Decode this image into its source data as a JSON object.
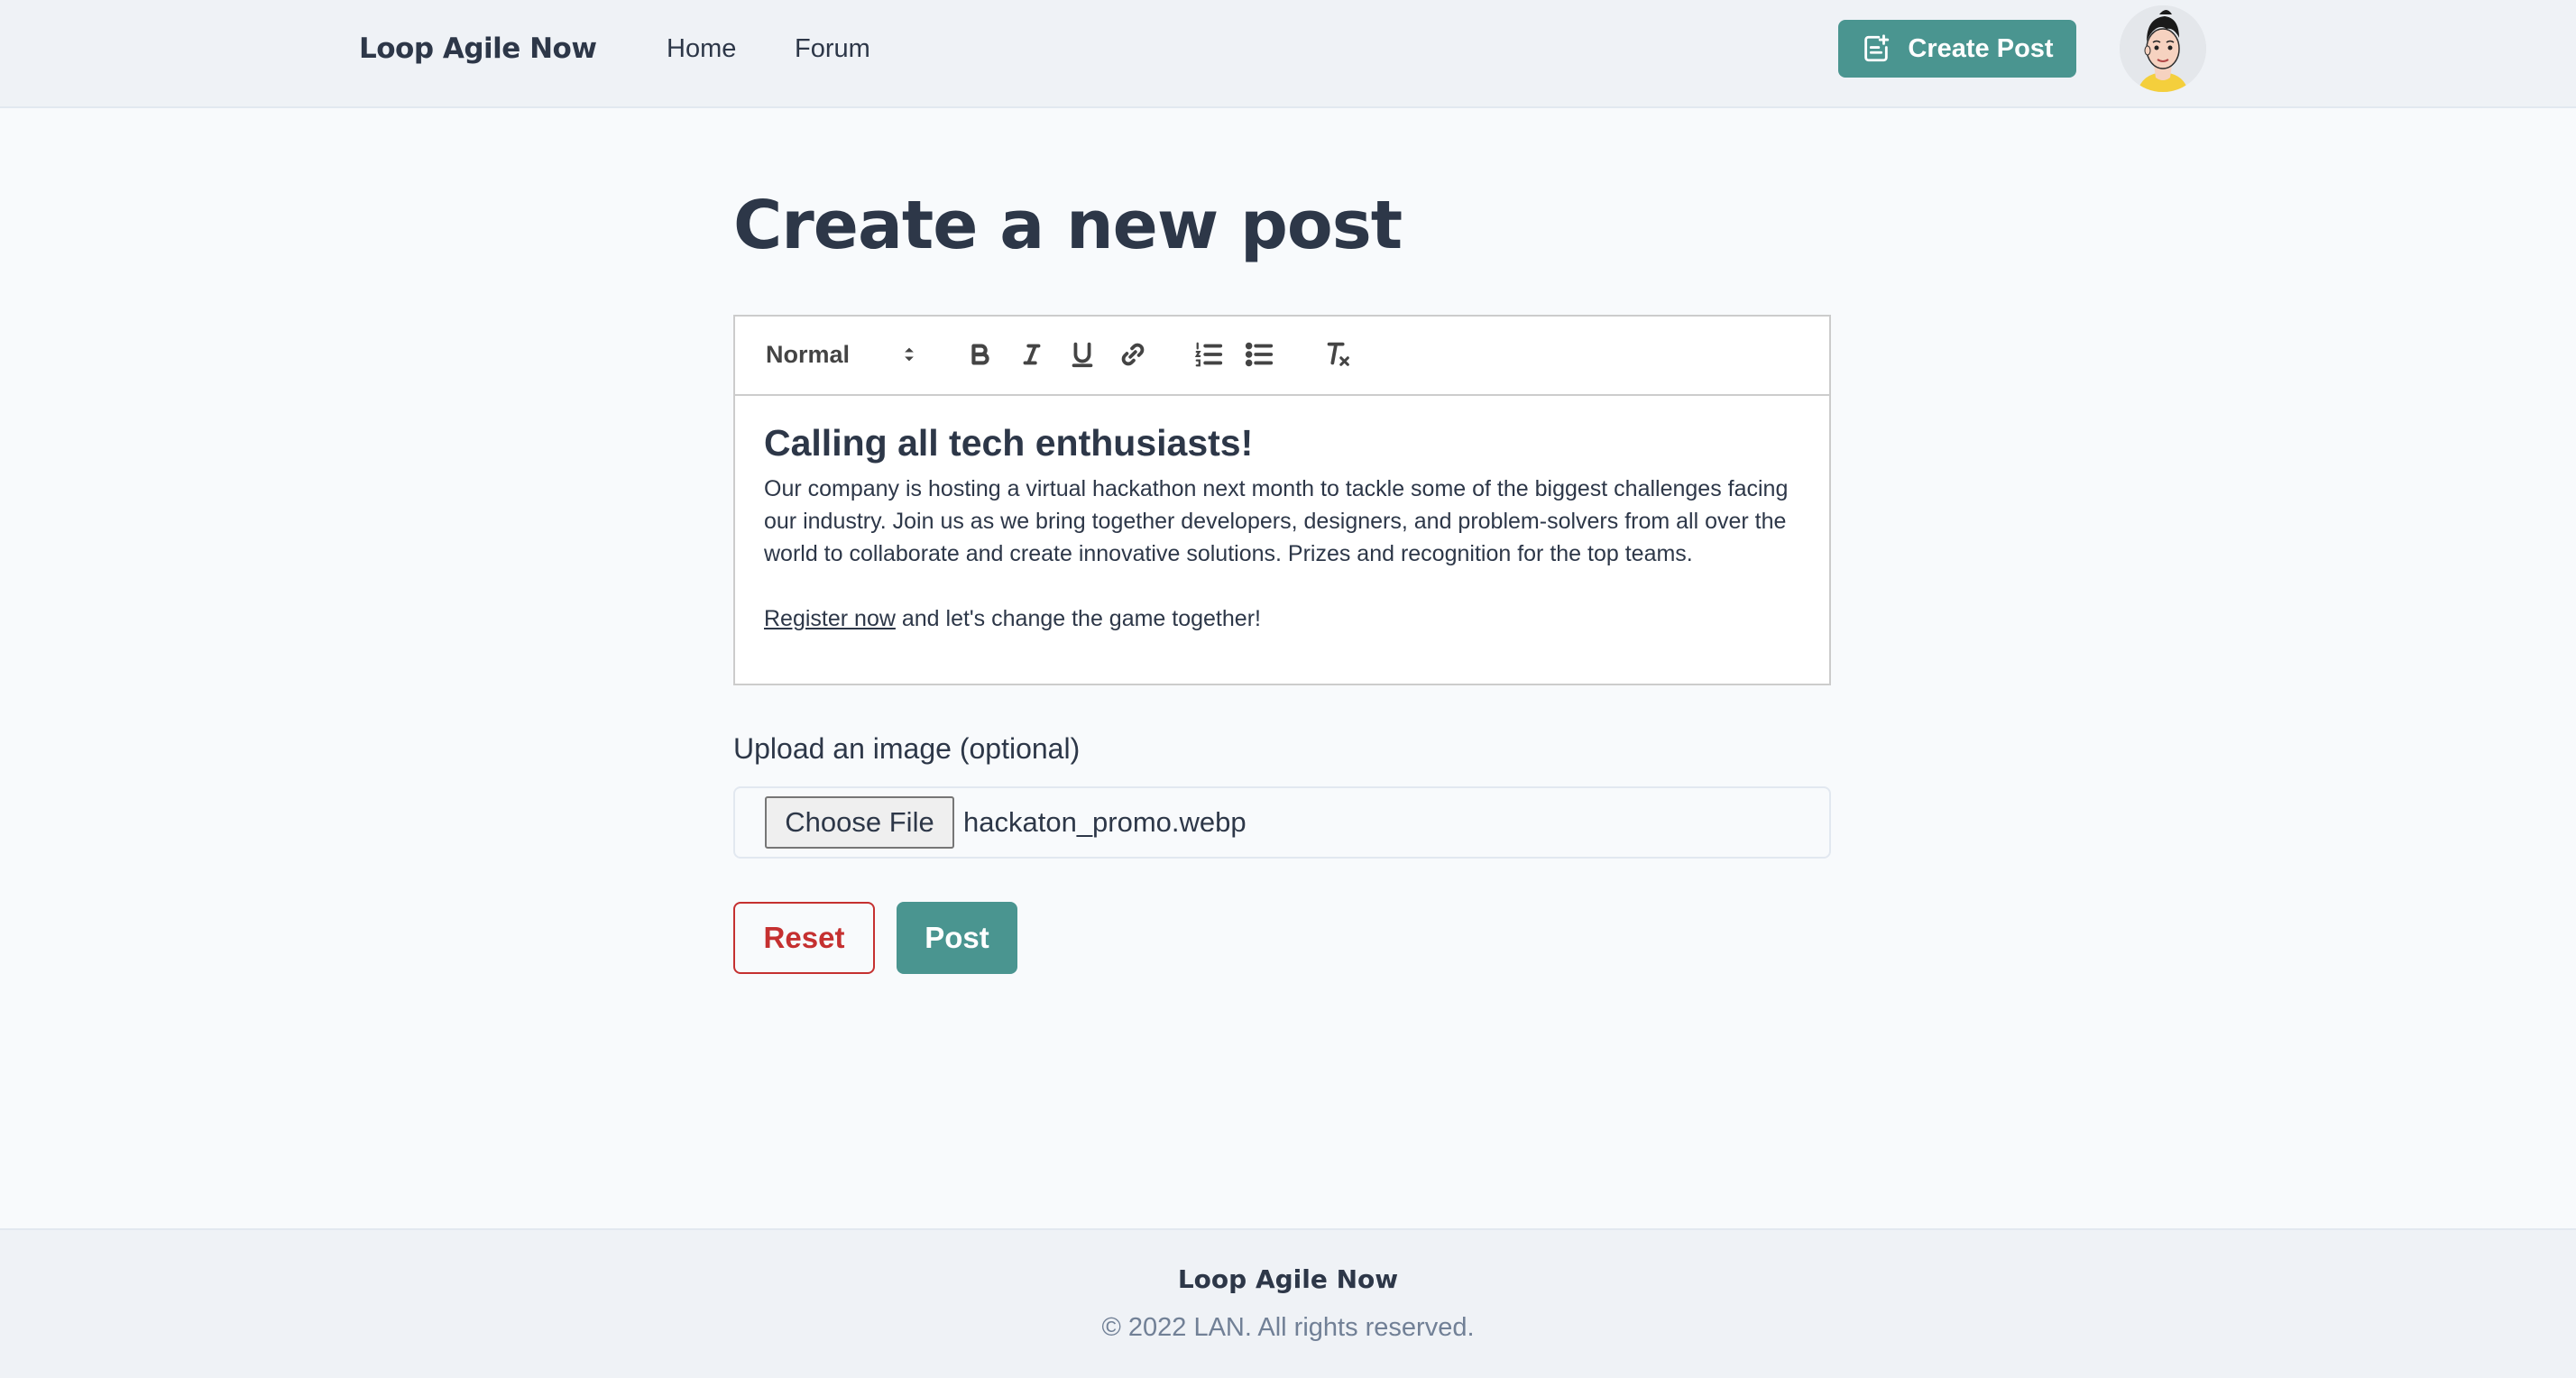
{
  "header": {
    "brand": "Loop Agile Now",
    "nav": [
      {
        "label": "Home"
      },
      {
        "label": "Forum"
      }
    ],
    "create_post_label": "Create Post",
    "create_post_icon": "note-add-icon",
    "avatar_icon": "user-avatar"
  },
  "main": {
    "title": "Create a new post",
    "editor": {
      "toolbar": {
        "header_select": "Normal",
        "icons": [
          "bold-icon",
          "italic-icon",
          "underline-icon",
          "link-icon",
          "ordered-list-icon",
          "bullet-list-icon",
          "clear-format-icon"
        ]
      },
      "heading": "Calling all tech enthusiasts!",
      "paragraph": "Our company is hosting a virtual hackathon next month to tackle some of the biggest challenges facing our industry. Join us as we bring together developers, designers, and problem-solvers from all over the world to collaborate and create innovative solutions. Prizes and recognition for the top teams.",
      "link_text": "Register now",
      "closing_text": " and let's change the game together!"
    },
    "upload": {
      "label": "Upload an image (optional)",
      "button_label": "Choose File",
      "file_name": "hackaton_promo.webp"
    },
    "reset_label": "Reset",
    "post_label": "Post"
  },
  "footer": {
    "brand": "Loop Agile Now",
    "copyright": "© 2022 LAN. All rights reserved."
  },
  "colors": {
    "accent": "#4a9590",
    "danger": "#c53030",
    "text": "#2d3748",
    "muted": "#718096",
    "header_bg": "#eff2f6",
    "page_bg": "#f8fafc"
  }
}
